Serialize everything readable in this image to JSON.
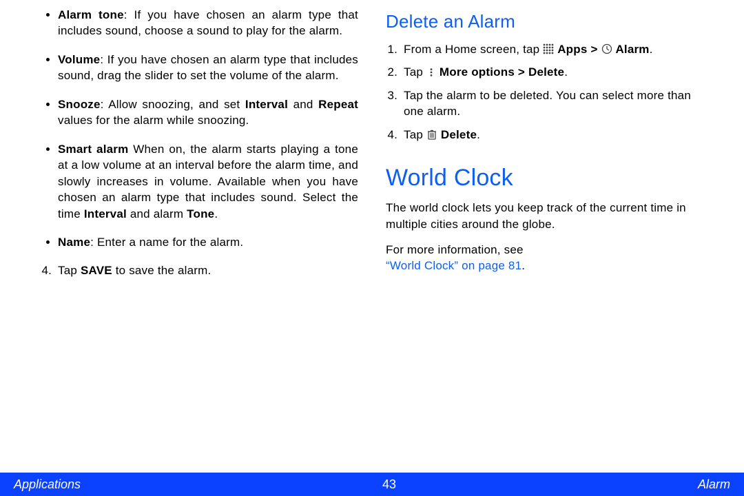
{
  "left": {
    "bullets": [
      {
        "term": "Alarm tone",
        "text": ": If you have chosen an alarm type that includes sound, choose a sound to play for the alarm."
      },
      {
        "term": "Volume",
        "text": ": If you have chosen an alarm type that includes sound, drag the slider to set the volume of the alarm."
      },
      {
        "term": "Snooze",
        "text_a": ": Allow snoozing, and set ",
        "mid1": "Interval",
        "text_b": " and ",
        "mid2": "Repeat",
        "text_c": " values for the alarm while snoozing."
      },
      {
        "term": "Smart alarm",
        "text_a": " When on, the alarm starts playing a tone at a low volume at an interval before the alarm time, and slowly increases in volume. Available when you have chosen an alarm type that includes sound. Select the time ",
        "mid1": "Interval",
        "text_b": " and alarm ",
        "mid2": "Tone",
        "text_c": "."
      },
      {
        "term": "Name",
        "text": ": Enter a name for the alarm."
      }
    ],
    "step4_a": "Tap ",
    "step4_bold": "SAVE",
    "step4_b": " to save the alarm."
  },
  "right": {
    "h_delete": "Delete an Alarm",
    "steps_delete": {
      "s1_a": "From a Home screen, tap ",
      "s1_apps": "Apps",
      "s1_gt": " > ",
      "s1_alarm": "Alarm",
      "s1_end": ".",
      "s2_a": "Tap ",
      "s2_more": "More options > Delete",
      "s2_end": ".",
      "s3": "Tap the alarm to be deleted. You can select more than one alarm.",
      "s4_a": "Tap ",
      "s4_delete": "Delete",
      "s4_end": "."
    },
    "h_world": "World Clock",
    "world_p1": "The world clock lets you keep track of the current time in multiple cities around the globe.",
    "world_p2": "For more information, see",
    "world_link": "“World Clock” on page 81",
    "world_link_end": "."
  },
  "footer": {
    "left": "Applications",
    "center": "43",
    "right": "Alarm"
  }
}
